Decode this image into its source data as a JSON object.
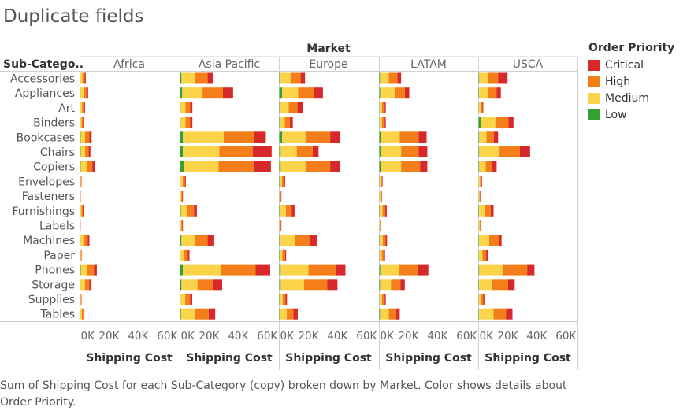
{
  "page_title": "Duplicate fields",
  "caption": "Sum of Shipping Cost for each Sub-Category (copy) broken down by Market.  Color shows details about Order Priority.",
  "legend": {
    "title": "Order Priority",
    "items": [
      {
        "label": "Critical",
        "color": "#d7282b"
      },
      {
        "label": "High",
        "color": "#f47f1a"
      },
      {
        "label": "Medium",
        "color": "#fcd44a"
      },
      {
        "label": "Low",
        "color": "#35a036"
      }
    ]
  },
  "chart_data": {
    "type": "bar",
    "stacked": true,
    "orientation": "horizontal",
    "column_header": "Market",
    "row_header": "Sub-Catego..",
    "xlabel": "Shipping Cost",
    "xlim": [
      0,
      65000
    ],
    "x_ticks": [
      "0K",
      "20K",
      "40K",
      "60K"
    ],
    "x_tick_values": [
      0,
      20000,
      40000,
      60000
    ],
    "stack_order": [
      "Low",
      "Medium",
      "High",
      "Critical"
    ],
    "categories": [
      "Accessories",
      "Appliances",
      "Art",
      "Binders",
      "Bookcases",
      "Chairs",
      "Copiers",
      "Envelopes",
      "Fasteners",
      "Furnishings",
      "Labels",
      "Machines",
      "Paper",
      "Phones",
      "Storage",
      "Supplies",
      "Tables"
    ],
    "panels": [
      {
        "market": "Africa",
        "values": {
          "Low": [
            200,
            400,
            150,
            150,
            500,
            500,
            500,
            100,
            50,
            150,
            50,
            300,
            100,
            600,
            400,
            100,
            200
          ],
          "Medium": [
            1500,
            2000,
            1300,
            1000,
            3000,
            3000,
            4000,
            400,
            200,
            900,
            200,
            2500,
            500,
            4000,
            3000,
            400,
            1100
          ],
          "High": [
            1500,
            2000,
            1300,
            1000,
            3000,
            2500,
            4000,
            400,
            200,
            900,
            150,
            2500,
            400,
            5000,
            3000,
            400,
            1100
          ],
          "Critical": [
            800,
            1200,
            700,
            500,
            1500,
            1200,
            2000,
            200,
            100,
            500,
            100,
            1200,
            200,
            2000,
            1500,
            200,
            600
          ]
        }
      },
      {
        "market": "Asia Pacific",
        "values": {
          "Low": [
            1000,
            1500,
            400,
            400,
            2000,
            2000,
            2500,
            300,
            200,
            600,
            200,
            1000,
            300,
            2000,
            1000,
            300,
            700
          ],
          "Medium": [
            9000,
            14000,
            3300,
            3300,
            28000,
            25000,
            24000,
            1500,
            700,
            4500,
            700,
            9000,
            2500,
            26000,
            11000,
            3300,
            9500
          ],
          "High": [
            9000,
            14000,
            3300,
            3300,
            21000,
            23000,
            24000,
            1500,
            700,
            4500,
            700,
            9000,
            2500,
            24000,
            11000,
            3300,
            9500
          ],
          "Critical": [
            3500,
            7000,
            1500,
            1500,
            8000,
            13000,
            12000,
            700,
            400,
            2000,
            400,
            4500,
            1200,
            10000,
            6000,
            1500,
            4500
          ]
        }
      },
      {
        "market": "Europe",
        "values": {
          "Low": [
            700,
            2000,
            500,
            300,
            2000,
            1000,
            1000,
            300,
            150,
            500,
            150,
            700,
            300,
            1000,
            1000,
            300,
            700
          ],
          "Medium": [
            7000,
            11000,
            6000,
            3500,
            16000,
            11000,
            17000,
            1500,
            500,
            4000,
            500,
            10000,
            1800,
            19000,
            16000,
            2000,
            4500
          ],
          "High": [
            7000,
            11000,
            6000,
            3500,
            17000,
            11000,
            17000,
            1500,
            500,
            4000,
            500,
            10000,
            1800,
            19000,
            16000,
            2000,
            4500
          ],
          "Critical": [
            3000,
            6000,
            3500,
            2000,
            7000,
            4000,
            7000,
            700,
            300,
            2000,
            300,
            5000,
            800,
            6500,
            7000,
            1000,
            3000
          ]
        }
      },
      {
        "market": "LATAM",
        "values": {
          "Low": [
            500,
            600,
            200,
            200,
            1000,
            1000,
            1000,
            200,
            100,
            300,
            100,
            300,
            200,
            700,
            500,
            200,
            500
          ],
          "Medium": [
            6000,
            10000,
            1700,
            1700,
            13000,
            14000,
            14000,
            800,
            700,
            1900,
            300,
            2000,
            1500,
            13000,
            7500,
            1700,
            6000
          ],
          "High": [
            6000,
            7000,
            1700,
            1700,
            13000,
            12000,
            13000,
            800,
            700,
            1900,
            300,
            2000,
            1500,
            13000,
            6500,
            1700,
            5000
          ],
          "Critical": [
            2500,
            3000,
            800,
            800,
            5500,
            6000,
            5000,
            400,
            300,
            1000,
            200,
            1000,
            700,
            7000,
            3000,
            800,
            2500
          ]
        }
      },
      {
        "market": "USCA",
        "values": {
          "Low": [
            400,
            300,
            200,
            1500,
            400,
            400,
            400,
            100,
            100,
            300,
            100,
            300,
            200,
            400,
            300,
            200,
            300
          ],
          "Medium": [
            6000,
            6000,
            1300,
            10000,
            5000,
            14000,
            4500,
            900,
            500,
            4000,
            600,
            7000,
            2500,
            16000,
            9000,
            1500,
            10000
          ],
          "High": [
            7000,
            6000,
            1200,
            9000,
            5000,
            14000,
            4500,
            900,
            500,
            4000,
            600,
            7000,
            2500,
            17000,
            11000,
            1500,
            8500
          ],
          "Critical": [
            6500,
            3000,
            500,
            3500,
            3000,
            7000,
            3000,
            400,
            200,
            2000,
            300,
            1500,
            1500,
            5000,
            4500,
            800,
            4500
          ]
        }
      }
    ]
  }
}
